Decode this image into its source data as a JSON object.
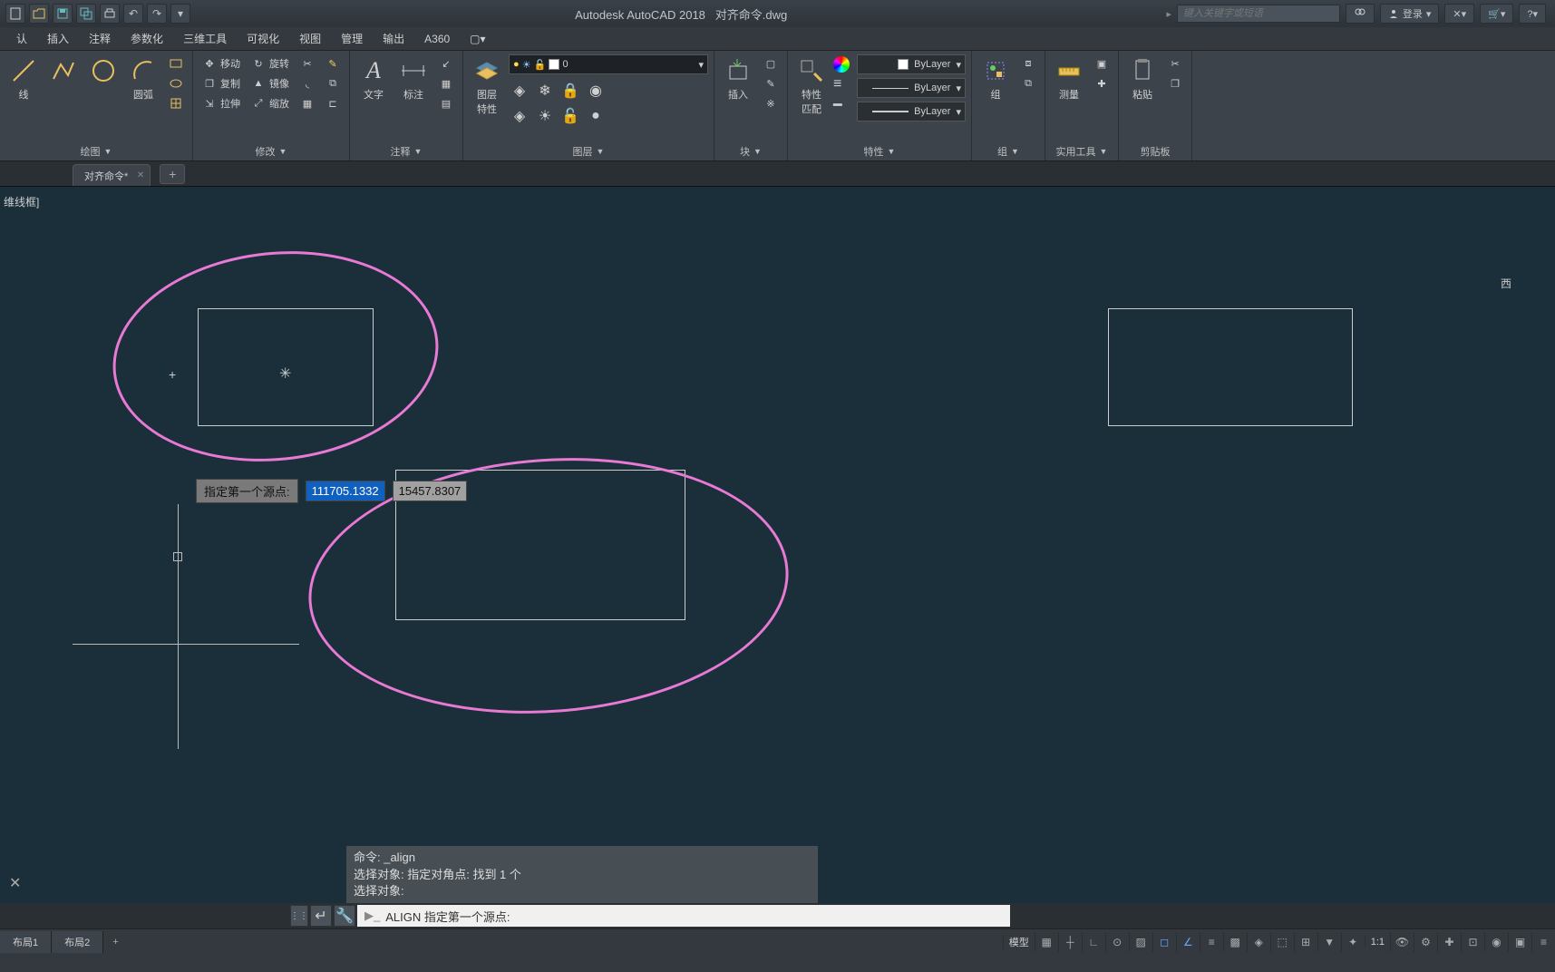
{
  "title": {
    "app": "Autodesk AutoCAD 2018",
    "file": "对齐命令.dwg"
  },
  "search": {
    "placeholder": "键入关键字或短语"
  },
  "login": "登录",
  "menu": [
    "认",
    "插入",
    "注释",
    "参数化",
    "三维工具",
    "可视化",
    "视图",
    "管理",
    "输出",
    "A360"
  ],
  "ribbon": {
    "draw": {
      "line": "线",
      "arc": "圆弧",
      "label": "绘图"
    },
    "modify": {
      "move": "移动",
      "rotate": "旋转",
      "copy": "复制",
      "mirror": "镜像",
      "stretch": "拉伸",
      "scale": "缩放",
      "label": "修改"
    },
    "annot": {
      "text": "文字",
      "dim": "标注",
      "label": "注释"
    },
    "layers": {
      "props": "图层\n特性",
      "current": "0",
      "label": "图层"
    },
    "block": {
      "insert": "插入",
      "label": "块"
    },
    "props": {
      "match": "特性\n匹配",
      "bylayer": "ByLayer",
      "label": "特性"
    },
    "group": {
      "group": "组",
      "label": "组"
    },
    "util": {
      "measure": "测量",
      "label": "实用工具"
    },
    "clip": {
      "paste": "粘贴",
      "label": "剪贴板"
    }
  },
  "filetab": {
    "name": "对齐命令*"
  },
  "canvas": {
    "corner_label": "维线框]",
    "viewcube": "西"
  },
  "dynamic_input": {
    "prompt": "指定第一个源点:",
    "x": "111705.1332",
    "y": "15457.8307"
  },
  "cmd_history": {
    "l1": "命令: _align",
    "l2": "选择对象: 指定对角点: 找到 1 个",
    "l3": "选择对象:"
  },
  "cmdline": {
    "text": "ALIGN 指定第一个源点:"
  },
  "status": {
    "model": "模型",
    "layout1": "布局1",
    "layout2": "布局2",
    "scale": "1:1"
  }
}
